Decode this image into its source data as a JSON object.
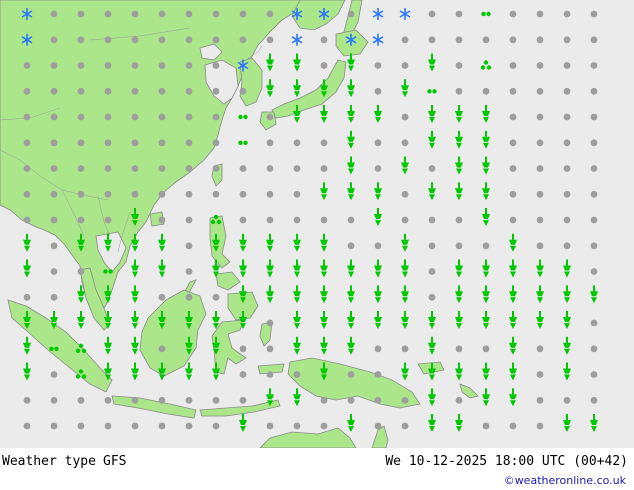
{
  "title": "Weather type",
  "model": "GFS",
  "valid_time": "We 10-12-2025 18:00 UTC (00+42)",
  "credit": "©weatheronline.co.uk",
  "colors": {
    "sea": "#ebebeb",
    "land": "#abe68a",
    "coast": "#8a8a8a",
    "cloud_symbol": "#9e9e9e",
    "rain_symbol": "#00c800",
    "snow_symbol": "#2a78ff",
    "credit": "#1a1ab0"
  },
  "symbol_legend": {
    "o": "cloud-symbol",
    "r": "rain-symbol",
    "s": "snow-symbol",
    "d": "drizzle-symbol",
    "t": "shower-symbol"
  },
  "grid_rows": [
    "sooooooooossossoodoooo",
    "sooooooooosossoooooooo",
    "oooooooosrroroorotoooo",
    "ooooooooorrrrordoooooo",
    "oooooooodorrrrorrroooo",
    "oooooooodoooroorrroooo",
    "oooooooooooorororroooo",
    "ooooooooooorrrorrroooo",
    "oooorootoooooroooroooo",
    "rorrrrorrrrroorooorooo",
    "roodrrorrrrrrrrorrrrro",
    "oorrrooorrrrrrrorrrrrr",
    "rrrrrrrrrorrrrrrrrrrro",
    "rdtrrorroorrrooroororo",
    "rotrrrrroooroorrrrroro",
    "ooooooooorroooororrooo",
    "ooooooooroooroorrooorr"
  ]
}
